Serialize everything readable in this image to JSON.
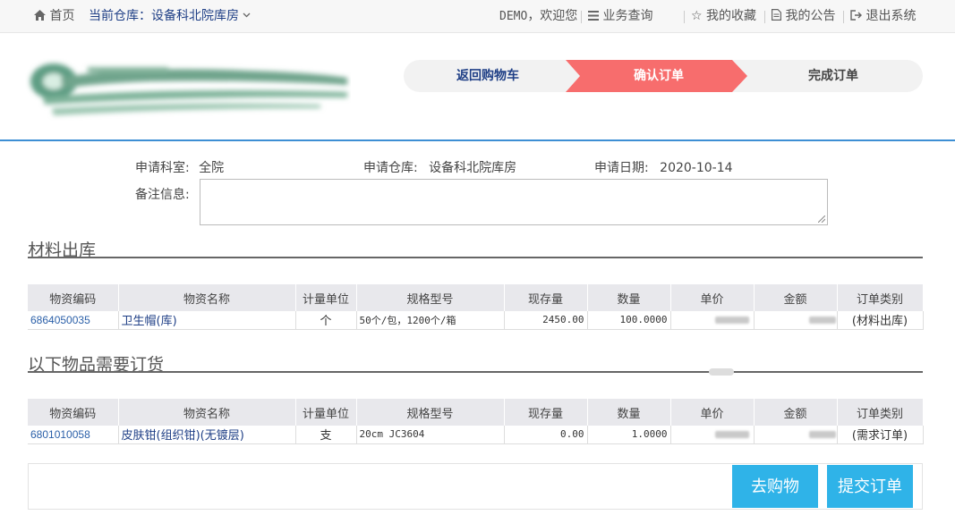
{
  "topbar": {
    "home": "首页",
    "warehouse_prefix": "当前仓库：",
    "warehouse_name": "设备科北院库房",
    "greeting_user": "DEMO",
    "greeting_text": "，欢迎您",
    "query": "业务查询",
    "favorites": "我的收藏",
    "notices": "我的公告",
    "logout": "退出系统"
  },
  "steps": [
    "返回购物车",
    "确认订单",
    "完成订单"
  ],
  "form": {
    "dept_label": "申请科室:",
    "dept_value": "全院",
    "warehouse_label": "申请仓库:",
    "warehouse_value": "设备科北院库房",
    "date_label": "申请日期:",
    "date_value": "2020-10-14",
    "remark_label": "备注信息:",
    "remark_value": ""
  },
  "columns": [
    "物资编码",
    "物资名称",
    "计量单位",
    "规格型号",
    "现存量",
    "数量",
    "单价",
    "金额",
    "订单类别"
  ],
  "section1": {
    "title": "材料出库",
    "rows": [
      {
        "code": "6864050035",
        "name": "卫生帽(库)",
        "unit": "个",
        "spec": "50个/包，1200个/箱",
        "stock": "2450.00",
        "qty": "100.0000",
        "type": "(材料出库)"
      }
    ]
  },
  "section2": {
    "title": "以下物品需要订货",
    "rows": [
      {
        "code": "6801010058",
        "name": "皮肤钳(组织钳)(无镀层)",
        "unit": "支",
        "spec": "20cm JC3604",
        "stock": "0.00",
        "qty": "1.0000",
        "type": "(需求订单)"
      }
    ]
  },
  "buttons": {
    "shop": "去购物",
    "submit": "提交订单"
  },
  "colors": {
    "accent_blue": "#2fb3e8",
    "step_active": "#f76d6d",
    "header_border": "#3d8fd4"
  }
}
